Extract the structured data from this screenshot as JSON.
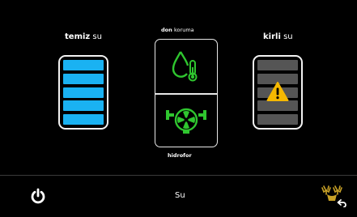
{
  "clean_water": {
    "title_bold": "temiz",
    "title_light": "su",
    "level_segments": 5
  },
  "dirty_water": {
    "title_bold": "kirli",
    "title_light": "su",
    "level_segments": 5,
    "warning_icon": "warning-triangle-icon"
  },
  "frost_protection": {
    "title_bold": "don",
    "title_light": "koruma",
    "icon": "water-drop-thermometer-icon"
  },
  "pump": {
    "label": "hidrofor",
    "icon": "pump-fan-icon"
  },
  "bottom_bar": {
    "power_icon": "power-icon",
    "title": "Su",
    "back_icon": "deer-back-icon"
  },
  "colors": {
    "clean": "#1ab2f2",
    "dirty": "#555555",
    "icon_green": "#2fc62f",
    "warning": "#f5b800",
    "gold": "#c9a227"
  }
}
